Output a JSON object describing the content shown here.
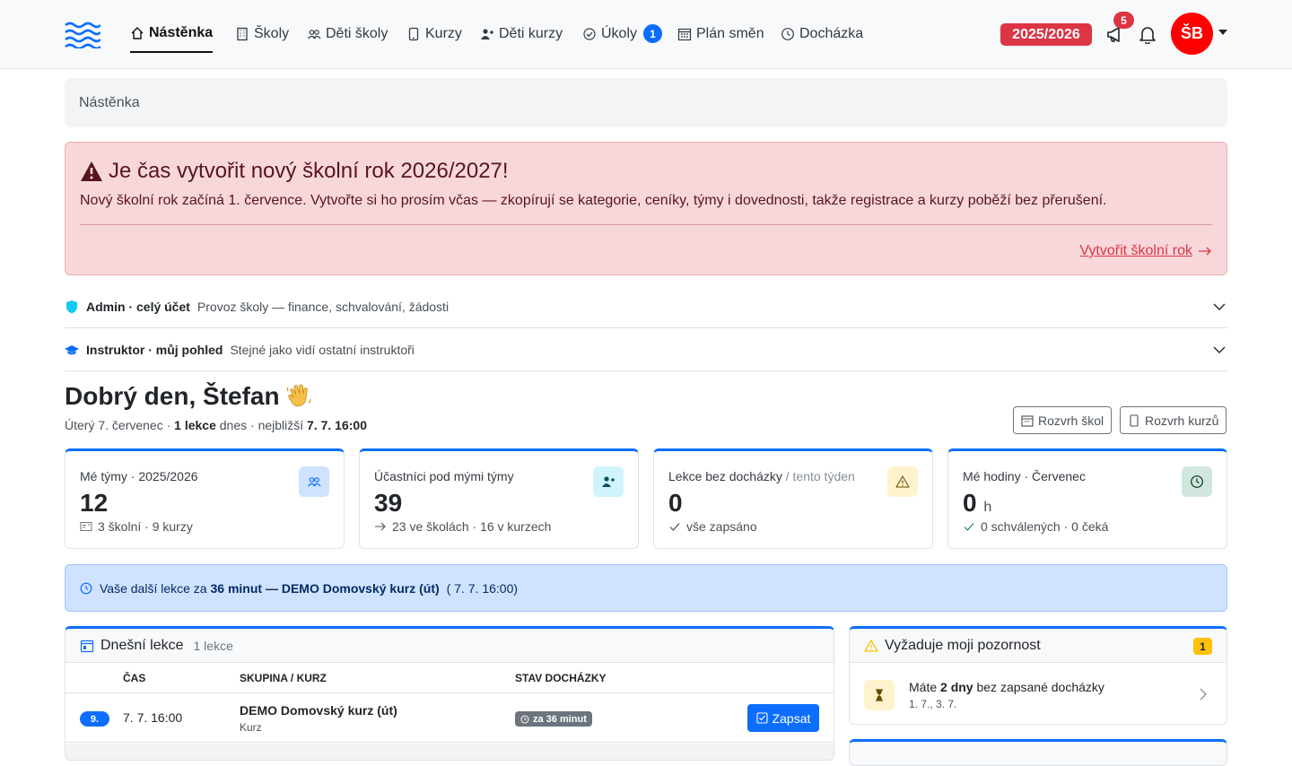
{
  "nav": {
    "items": [
      {
        "label": "Nástěnka",
        "icon": "home-icon",
        "active": true
      },
      {
        "label": "Školy",
        "icon": "building-icon"
      },
      {
        "label": "Děti školy",
        "icon": "people-icon"
      },
      {
        "label": "Kurzy",
        "icon": "phone-icon"
      },
      {
        "label": "Děti kurzy",
        "icon": "person-plus-icon"
      },
      {
        "label": "Úkoly",
        "icon": "check-circle-icon",
        "badge": "1"
      },
      {
        "label": "Plán směn",
        "icon": "calendar-grid-icon"
      },
      {
        "label": "Docházka",
        "icon": "clock-icon"
      }
    ],
    "year": "2025/2026",
    "announcements_count": "5",
    "avatar_initials": "ŠB"
  },
  "breadcrumb": "Nástěnka",
  "alert": {
    "title": "Je čas vytvořit nový školní rok 2026/2027!",
    "text": "Nový školní rok začíná 1. července. Vytvořte si ho prosím včas — zkopírují se kategorie, ceníky, týmy i dovednosti, takže registrace a kurzy poběží bez přerušení.",
    "link": "Vytvořit školní rok"
  },
  "accordions": [
    {
      "title": "Admin · celý účet",
      "subtitle": "Provoz školy — finance, schvalování, žádosti",
      "icon": "shield-icon"
    },
    {
      "title": "Instruktor · můj pohled",
      "subtitle": "Stejné jako vidí ostatní instruktoři",
      "icon": "graduation-cap-icon"
    }
  ],
  "greeting": {
    "title": "Dobrý den, Štefan",
    "sub_prefix": "Úterý 7. červenec · ",
    "sub_lessons": "1 lekce",
    "sub_mid": " dnes · nejbližší ",
    "sub_next": "7. 7. 16:00",
    "buttons": [
      "Rozvrh škol",
      "Rozvrh kurzů"
    ]
  },
  "stats": [
    {
      "label": "Mé týmy · 2025/2026",
      "muted": "",
      "value": "12",
      "unit": "",
      "foot": "3 školní · 9 kurzy",
      "icon": "people-icon",
      "icon_bg": "#cfe2ff",
      "icon_color": "#0d6efd"
    },
    {
      "label": "Účastníci pod mými týmy",
      "muted": "",
      "value": "39",
      "unit": "",
      "foot": "23 ve školách · 16 v kurzech",
      "icon": "person-plus-icon",
      "icon_bg": "#cff4fc",
      "icon_color": "#055160"
    },
    {
      "label": "Lekce bez docházky",
      "muted": " / tento týden",
      "value": "0",
      "unit": "",
      "foot": "vše zapsáno",
      "icon": "warning-icon",
      "icon_bg": "#fff3cd",
      "icon_color": "#664d03"
    },
    {
      "label": "Mé hodiny · Červenec",
      "muted": "",
      "value": "0",
      "unit": "h",
      "foot": "0 schválených · 0 čeká",
      "icon": "clock-icon",
      "icon_bg": "#d1e7dd",
      "icon_color": "#0a3622"
    }
  ],
  "info": {
    "prefix": "Vaše další lekce za ",
    "minutes": "36 minut",
    "dash": " — ",
    "course": "DEMO Domovský kurz (út)",
    "when": "( 7. 7. 16:00)"
  },
  "today": {
    "title": "Dnešní lekce",
    "count": "1 lekce",
    "columns": [
      "ČAS",
      "SKUPINA / KURZ",
      "STAV DOCHÁZKY"
    ],
    "rows": [
      {
        "num": "9.",
        "time": "7. 7. 16:00",
        "course": "DEMO Domovský kurz (út)",
        "type": "Kurz",
        "status": "za 36 minut",
        "action": "Zapsat"
      }
    ]
  },
  "attention": {
    "title": "Vyžaduje moji pozornost",
    "badge": "1",
    "item_prefix": "Máte ",
    "item_bold": "2 dny",
    "item_suffix": " bez zapsané docházky",
    "item_dates": "1. 7., 3. 7."
  }
}
